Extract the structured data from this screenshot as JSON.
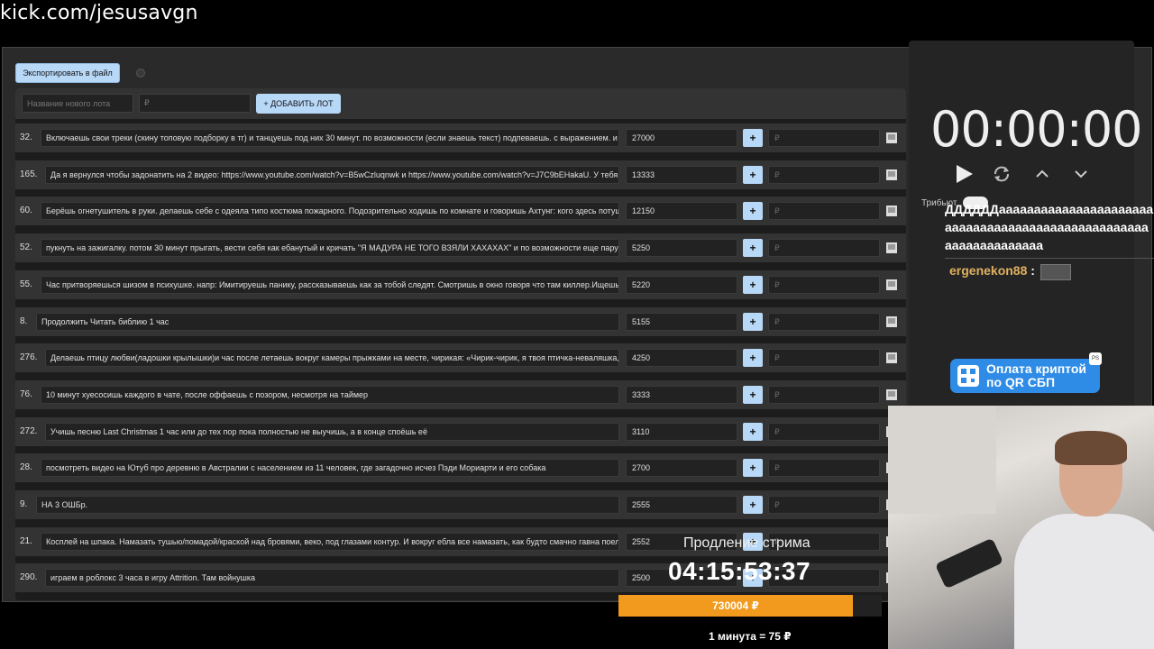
{
  "url": "kick.com/jesusavgn",
  "toolbar": {
    "export_label": "Экспортировать в файл"
  },
  "new_lot": {
    "name_placeholder": "Название нового лота",
    "amount_placeholder": "₽",
    "add_label": "+ ДОБАВИТЬ ЛОТ"
  },
  "lots": [
    {
      "num": "32.",
      "text": "Включаешь свои треки (скину топовую подборку в тг) и танцуешь под них 30 минут. по возможности (если знаешь текст) подпеваешь. с выражением. и и",
      "amount": "27000",
      "rub": "₽"
    },
    {
      "num": "165.",
      "text": "Да я вернулся чтобы задонатить на 2 видео: https://www.youtube.com/watch?v=B5wCzluqnwk и https://www.youtube.com/watch?v=J7C9bEHakaU. У тебя к",
      "amount": "13333",
      "rub": "₽"
    },
    {
      "num": "60.",
      "text": "Берёшь огнетушитель в руки. делаешь себе с одеяла типо костюма пожарного. Подозрительно ходишь по комнате и говоришь Ахтунг: кого здесь потуш",
      "amount": "12150",
      "rub": "₽"
    },
    {
      "num": "52.",
      "text": "пукнуть на зажигалку. потом 30 минут прыгать, вести себя как ебанутый и кричать \"Я МАДУРА НЕ ТОГО ВЗЯЛИ ХАХАХАХ\" и по возможности еще пару р",
      "amount": "5250",
      "rub": "₽"
    },
    {
      "num": "55.",
      "text": "Час притворяешься шизом в психушке. напр: Имитируешь панику, рассказываешь как за тобой следят. Смотришь в окно говоря что там киллер.Ищешь с",
      "amount": "5220",
      "rub": "₽"
    },
    {
      "num": "8.",
      "text": "Продолжить Читать библию 1 час",
      "amount": "5155",
      "rub": "₽"
    },
    {
      "num": "276.",
      "text": "Делаешь птицу любви(ладошки крылышки)и час после летаешь вокруг камеры прыжками на месте, чирикая: «Чирик-чирик, я твоя птичка-неваляшка, г",
      "amount": "4250",
      "rub": "₽"
    },
    {
      "num": "76.",
      "text": "10 минут хуесосишь каждого в чате, после оффаешь с позором, несмотря на таймер",
      "amount": "3333",
      "rub": "₽"
    },
    {
      "num": "272.",
      "text": "Учишь песню Last Christmas 1 час или до тех пор пока полностью не выучишь, а в конце споёшь её",
      "amount": "3110",
      "rub": "₽"
    },
    {
      "num": "28.",
      "text": "посмотреть видео на Ютуб про деревню в Австралии с населением из 11 человек, где загадочно исчез Пэди Мориарти и его собака",
      "amount": "2700",
      "rub": "₽"
    },
    {
      "num": "9.",
      "text": "НА 3 ОШБр.",
      "amount": "2555",
      "rub": "₽"
    },
    {
      "num": "21.",
      "text": "Косплей на шпака. Намазать тушью/помадой/краской над бровями, веко, под глазами контур. И вокруг ебла все намазать, как будто смачно гавна поел.",
      "amount": "2552",
      "rub": "₽"
    },
    {
      "num": "290.",
      "text": "играем в роблокс 3 часа в игру Attrition. Там войнушка",
      "amount": "2500",
      "rub": "₽"
    }
  ],
  "timer": {
    "value": "00:00:00",
    "tribute_label": "Трибьют"
  },
  "chat": {
    "message": "ДДДДДДааааааааааааааааааааааааааааааааааааааааааааааааааааааааааааааааа",
    "username": "ergenekon88",
    "separator": ":"
  },
  "qr": {
    "label_line1": "Оплата криптой",
    "label_line2": "по QR СБП"
  },
  "extension": {
    "label": "Продление стрима",
    "timer": "04:15:53:37",
    "total": "730004 ₽",
    "progress_percent": 89,
    "rate": "1 минута = 75 ₽"
  },
  "colors": {
    "accent": "#b8d8f8",
    "progress": "#f29a1e",
    "qr_button": "#2e8be6",
    "username": "#e0b060"
  }
}
